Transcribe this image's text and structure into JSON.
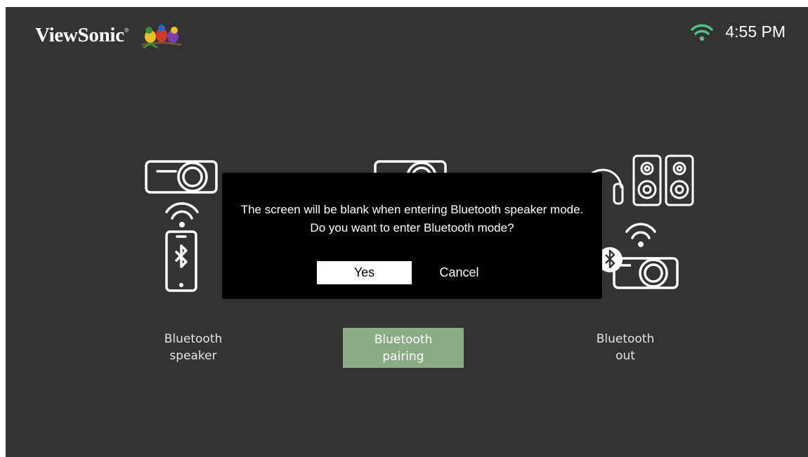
{
  "brand": {
    "name": "ViewSonic",
    "mark": "®"
  },
  "status": {
    "time": "4:55 PM",
    "wifi_icon": "wifi-icon",
    "wifi_color": "#4fc38a"
  },
  "options": [
    {
      "label": "Bluetooth\nspeaker",
      "icon": "phone-to-projector-icon",
      "selected": false
    },
    {
      "label": "Bluetooth\npairing",
      "icon": "projector-icon",
      "selected": true
    },
    {
      "label": "Bluetooth\nout",
      "icon": "projector-to-speakers-icon",
      "selected": false
    }
  ],
  "dialog": {
    "line1": "The screen will be blank when entering Bluetooth speaker mode.",
    "line2": "Do you want to enter Bluetooth mode?",
    "yes_label": "Yes",
    "cancel_label": "Cancel"
  },
  "colors": {
    "background": "#323332",
    "selected": "#8aab84",
    "dialog": "#000000"
  }
}
